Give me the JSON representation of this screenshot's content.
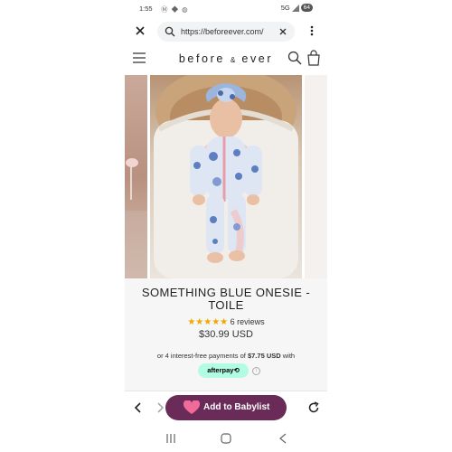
{
  "status_bar": {
    "time": "1:55",
    "left_icons": "Ⓜ ◆ ◍",
    "network": "5G",
    "battery": "64"
  },
  "browser": {
    "url": "https://beforeever.com/",
    "icons": [
      "close-icon",
      "search-icon",
      "clear-icon",
      "more-vert-icon"
    ]
  },
  "site_header": {
    "brand_left": "before",
    "brand_amp": "&",
    "brand_right": "ever",
    "icons": [
      "hamburger-icon",
      "search-icon",
      "bag-icon"
    ]
  },
  "product": {
    "title": "SOMETHING BLUE ONESIE - TOILE",
    "stars": "★★★★★",
    "rating_value": 5,
    "reviews": "6 reviews",
    "price": "$30.99 USD",
    "installment_prefix": "or 4 interest-free payments of",
    "installment_amount": "$7.75 USD",
    "installment_suffix": "with",
    "afterpay_label": "afterpay⟲",
    "info_glyph": "i"
  },
  "bottom_toolbar": {
    "babylist_label": "Add to Babylist",
    "icons": [
      "back-icon",
      "forward-icon",
      "heart-icon",
      "reload-icon"
    ]
  },
  "colors": {
    "babylist_purple": "#6a2b58",
    "afterpay_mint": "#b2fce4",
    "star_gold": "#f0a800",
    "heart_pink": "#f06b9a"
  }
}
